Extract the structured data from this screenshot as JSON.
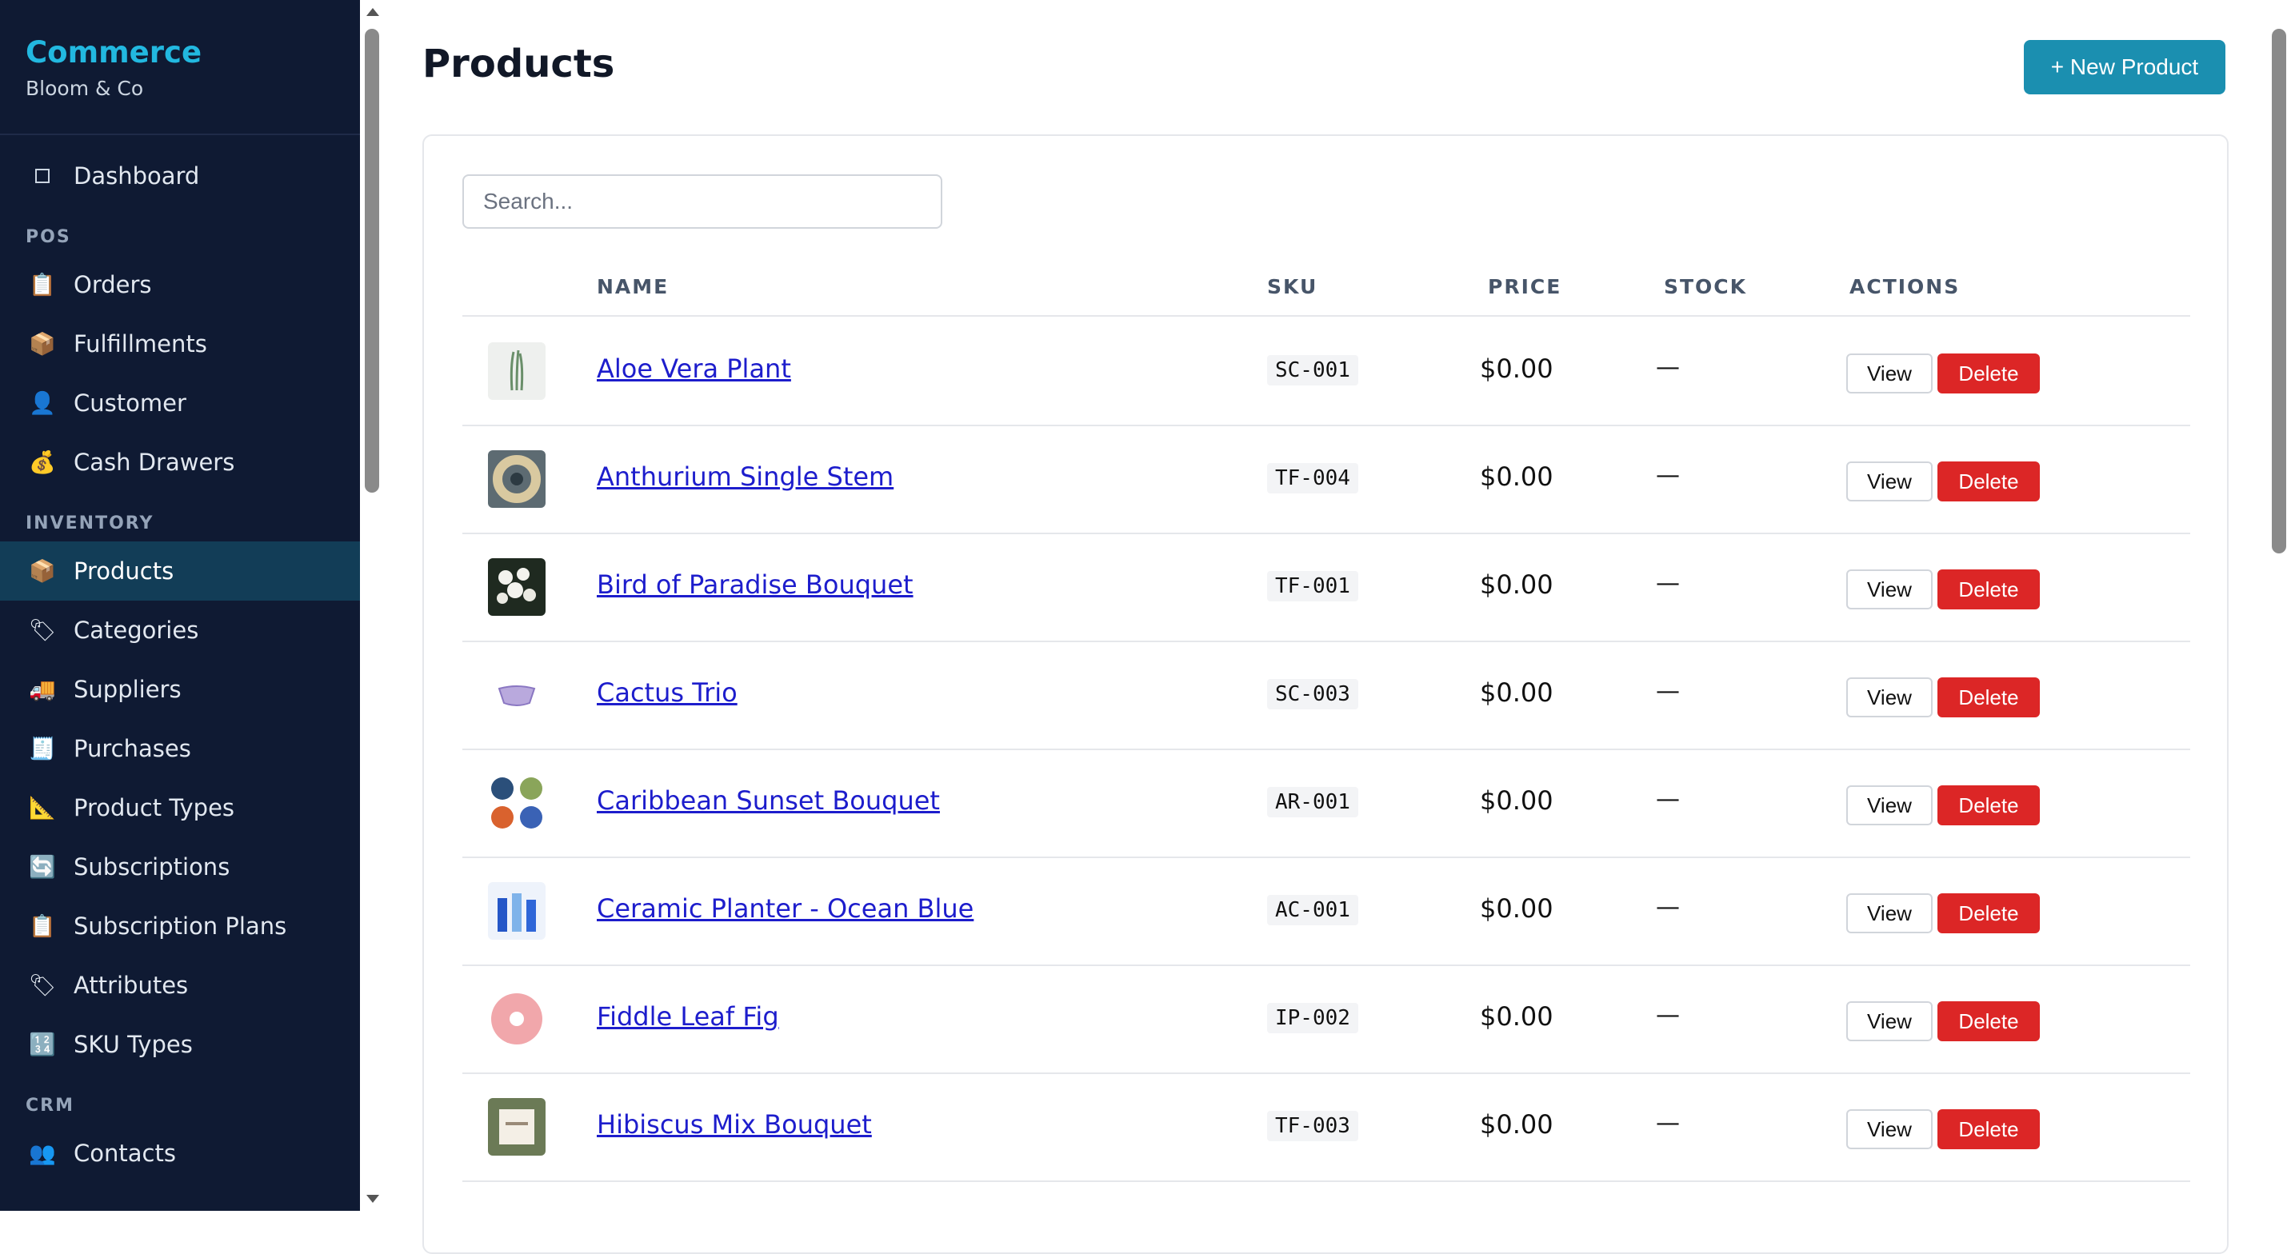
{
  "brand": {
    "title": "Commerce",
    "subtitle": "Bloom & Co"
  },
  "sidebar": {
    "dashboard": {
      "label": "Dashboard",
      "icon": "square-icon"
    },
    "sections": [
      {
        "title": "POS",
        "items": [
          {
            "label": "Orders",
            "icon": "clipboard-icon",
            "glyph": "📋"
          },
          {
            "label": "Fulfillments",
            "icon": "package-icon",
            "glyph": "📦"
          },
          {
            "label": "Customer",
            "icon": "user-icon",
            "glyph": "👤"
          },
          {
            "label": "Cash Drawers",
            "icon": "money-bag-icon",
            "glyph": "💰"
          }
        ]
      },
      {
        "title": "INVENTORY",
        "items": [
          {
            "label": "Products",
            "icon": "package-icon",
            "glyph": "📦",
            "active": true
          },
          {
            "label": "Categories",
            "icon": "tag-icon",
            "glyph": "🏷"
          },
          {
            "label": "Suppliers",
            "icon": "truck-icon",
            "glyph": "🚚"
          },
          {
            "label": "Purchases",
            "icon": "receipt-icon",
            "glyph": "🧾"
          },
          {
            "label": "Product Types",
            "icon": "ruler-icon",
            "glyph": "📐"
          },
          {
            "label": "Subscriptions",
            "icon": "refresh-icon",
            "glyph": "🔄"
          },
          {
            "label": "Subscription Plans",
            "icon": "clipboard-icon",
            "glyph": "📋"
          },
          {
            "label": "Attributes",
            "icon": "tag-icon",
            "glyph": "🏷"
          },
          {
            "label": "SKU Types",
            "icon": "numbers-icon",
            "glyph": "🔢"
          }
        ]
      },
      {
        "title": "CRM",
        "items": [
          {
            "label": "Contacts",
            "icon": "people-icon",
            "glyph": "👥"
          }
        ]
      }
    ]
  },
  "header": {
    "title": "Products",
    "new_button": "+ New Product"
  },
  "search": {
    "placeholder": "Search..."
  },
  "table": {
    "columns": [
      "NAME",
      "SKU",
      "PRICE",
      "STOCK",
      "ACTIONS"
    ],
    "view_label": "View",
    "delete_label": "Delete",
    "rows": [
      {
        "name": "Aloe Vera Plant",
        "sku": "SC-001",
        "price": "$0.00",
        "stock": "—",
        "thumb": "aloe"
      },
      {
        "name": "Anthurium Single Stem",
        "sku": "TF-004",
        "price": "$0.00",
        "stock": "—",
        "thumb": "wreath"
      },
      {
        "name": "Bird of Paradise Bouquet",
        "sku": "TF-001",
        "price": "$0.00",
        "stock": "—",
        "thumb": "white-flowers"
      },
      {
        "name": "Cactus Trio",
        "sku": "SC-003",
        "price": "$0.00",
        "stock": "—",
        "thumb": "basket"
      },
      {
        "name": "Caribbean Sunset Bouquet",
        "sku": "AR-001",
        "price": "$0.00",
        "stock": "—",
        "thumb": "circles"
      },
      {
        "name": "Ceramic Planter - Ocean Blue",
        "sku": "AC-001",
        "price": "$0.00",
        "stock": "—",
        "thumb": "blue-bottles"
      },
      {
        "name": "Fiddle Leaf Fig",
        "sku": "IP-002",
        "price": "$0.00",
        "stock": "—",
        "thumb": "pink-donut"
      },
      {
        "name": "Hibiscus Mix Bouquet",
        "sku": "TF-003",
        "price": "$0.00",
        "stock": "—",
        "thumb": "card"
      }
    ]
  },
  "colors": {
    "sidebar_bg": "#0f1a33",
    "brand": "#22b8e0",
    "active": "#123d57",
    "primary": "#1b8fb0",
    "danger": "#dc2626",
    "link": "#1d1dcc"
  }
}
